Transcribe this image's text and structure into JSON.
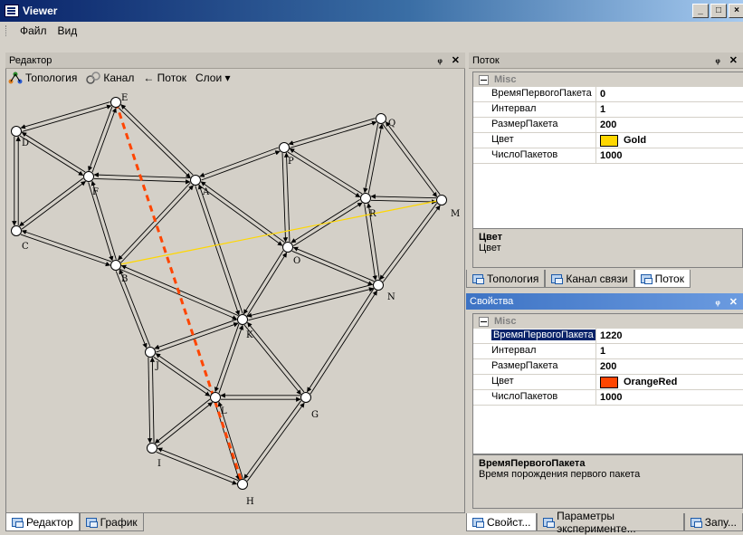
{
  "window": {
    "title": "Viewer",
    "buttons": [
      "_",
      "□",
      "×"
    ]
  },
  "menu": [
    "Файл",
    "Вид"
  ],
  "editor": {
    "panel_title": "Редактор",
    "toolbar": {
      "topology": "Топология",
      "channel": "Канал",
      "flow": "← Поток",
      "layers": "Слои ▾"
    },
    "tabs": [
      "Редактор",
      "График"
    ]
  },
  "flow_panel": {
    "title": "Поток",
    "category": "Misc",
    "rows": [
      {
        "key": "ВремяПервогоПакета",
        "value": "0"
      },
      {
        "key": "Интервал",
        "value": "1"
      },
      {
        "key": "РазмерПакета",
        "value": "200"
      },
      {
        "key": "Цвет",
        "value": "Gold",
        "swatch": "#ffd700"
      },
      {
        "key": "ЧислоПакетов",
        "value": "1000"
      }
    ],
    "desc_title": "Цвет",
    "desc_text": "Цвет",
    "tabs": [
      "Топология",
      "Канал связи",
      "Поток"
    ]
  },
  "props_panel": {
    "title": "Свойства",
    "category": "Misc",
    "rows": [
      {
        "key": "ВремяПервогоПакета",
        "value": "1220"
      },
      {
        "key": "Интервал",
        "value": "1"
      },
      {
        "key": "РазмерПакета",
        "value": "200"
      },
      {
        "key": "Цвет",
        "value": "OrangeRed",
        "swatch": "#ff4500"
      },
      {
        "key": "ЧислоПакетов",
        "value": "1000"
      }
    ],
    "desc_title": "ВремяПервогоПакета",
    "desc_text": "Время порождения первого пакета",
    "tabs": [
      "Свойст...",
      "Параметры эксперименте...",
      "Запу..."
    ]
  },
  "graph": {
    "nodes": [
      "E",
      "D",
      "F",
      "A",
      "P",
      "Q",
      "M",
      "R",
      "C",
      "B",
      "O",
      "N",
      "K",
      "J",
      "L",
      "G",
      "I",
      "H"
    ],
    "highlight_gold": "#ffd700",
    "highlight_red": "#ff4500"
  }
}
